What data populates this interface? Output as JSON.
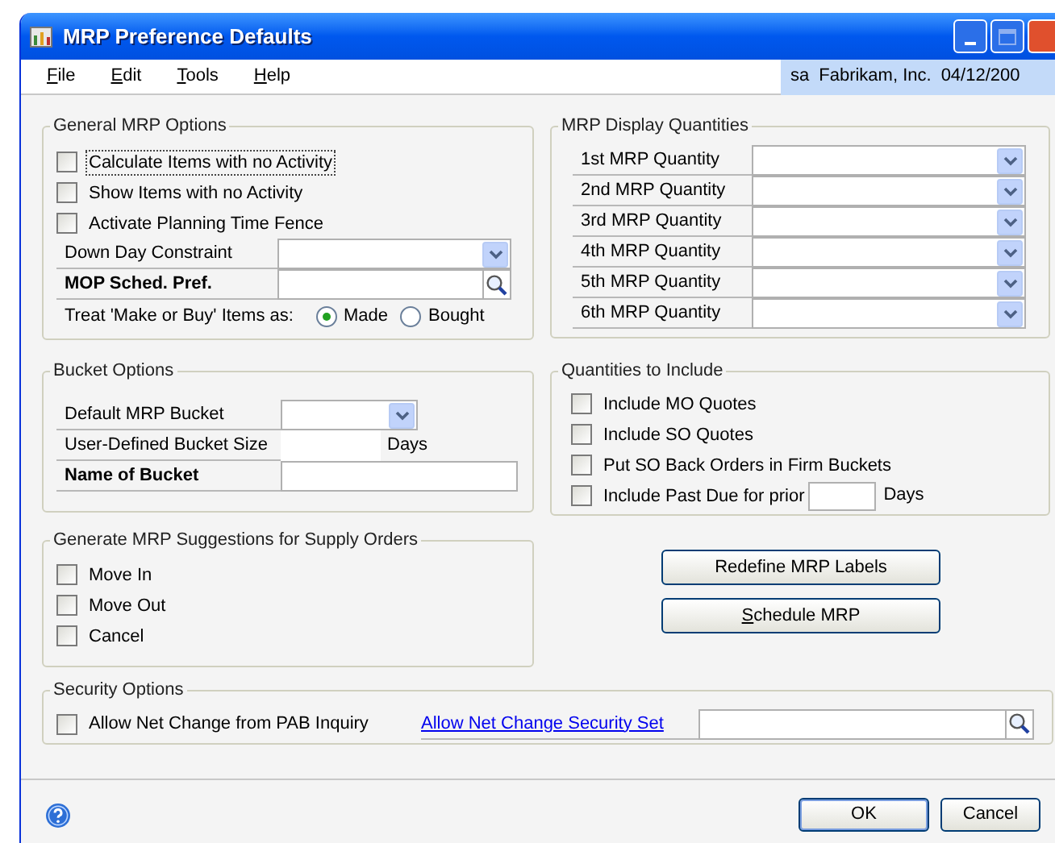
{
  "window": {
    "title": "MRP Preference Defaults"
  },
  "menu": [
    "File",
    "Edit",
    "Tools",
    "Help"
  ],
  "user_info": {
    "user": "sa",
    "company": "Fabrikam, Inc.",
    "date": "04/12/200"
  },
  "general_options": {
    "title": "General MRP Options",
    "checkboxes": [
      {
        "label": "Calculate Items with no Activity",
        "checked": false,
        "focused": true
      },
      {
        "label": "Show Items with no Activity",
        "checked": false,
        "focused": false
      },
      {
        "label": "Activate Planning Time Fence",
        "checked": false,
        "focused": false
      }
    ],
    "fields": [
      {
        "kind": "dropdown",
        "label": "Down Day Constraint",
        "required": false
      },
      {
        "kind": "lookup",
        "label": "MOP Sched. Pref.",
        "required": true
      }
    ],
    "make_or_buy": {
      "label": "Treat 'Make or Buy' Items as:",
      "options": [
        {
          "label": "Made",
          "selected": true
        },
        {
          "label": "Bought",
          "selected": false
        }
      ]
    }
  },
  "display_quantities": {
    "title": "MRP Display Quantities",
    "rows": [
      {
        "label": "1st MRP Quantity"
      },
      {
        "label": "2nd MRP Quantity"
      },
      {
        "label": "3rd MRP Quantity"
      },
      {
        "label": "4th MRP Quantity"
      },
      {
        "label": "5th MRP Quantity"
      },
      {
        "label": "6th MRP Quantity"
      }
    ]
  },
  "bucket_options": {
    "title": "Bucket Options",
    "fields": [
      {
        "kind": "dropdown",
        "label": "Default MRP Bucket",
        "required": false
      },
      {
        "kind": "number",
        "label": "User-Defined Bucket Size",
        "unit": "Days",
        "required": false
      },
      {
        "kind": "text",
        "label": "Name of Bucket",
        "required": true
      }
    ]
  },
  "quantities_to_include": {
    "title": "Quantities to Include",
    "checkboxes": [
      {
        "kind": "checkbox",
        "label": "Include MO Quotes",
        "checked": false
      },
      {
        "kind": "checkbox",
        "label": "Include SO Quotes",
        "checked": false
      },
      {
        "kind": "checkbox",
        "label": "Put SO Back Orders in Firm Buckets",
        "checked": false
      },
      {
        "kind": "days",
        "label": "Include Past Due for prior",
        "unit": "Days",
        "checked": false
      }
    ]
  },
  "supply_suggestions": {
    "title": "Generate MRP Suggestions for Supply Orders",
    "checkboxes": [
      {
        "label": "Move In",
        "checked": false
      },
      {
        "label": "Move Out",
        "checked": false
      },
      {
        "label": "Cancel",
        "checked": false
      }
    ]
  },
  "action_buttons": [
    {
      "label": "Redefine MRP Labels",
      "underline_first": false
    },
    {
      "label": "Schedule MRP",
      "underline_first": true
    }
  ],
  "security_options": {
    "title": "Security Options",
    "checkbox": {
      "label": "Allow Net Change from PAB Inquiry",
      "checked": false
    },
    "link": "Allow Net Change Security Set"
  },
  "footer_buttons": [
    {
      "label": "OK",
      "default": true
    },
    {
      "label": "Cancel",
      "default": false
    }
  ]
}
